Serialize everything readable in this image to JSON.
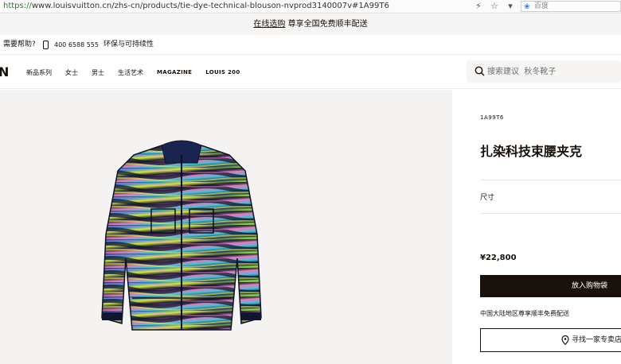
{
  "browser": {
    "url_scheme": "https://",
    "url_rest": "www.louisvuitton.cn/zhs-cn/products/tie-dye-technical-blouson-nvprod3140007v#1A99T6",
    "search_engine": "百度",
    "icons": [
      "lightning-icon",
      "star-icon",
      "dropdown-icon"
    ]
  },
  "announcement": {
    "link": "在线选购",
    "text": " 尊享全国免费顺丰配送"
  },
  "utility": {
    "help": "需要帮助?",
    "phone": "400 6588 555",
    "eco": "环保与可持续性"
  },
  "nav": {
    "logo_fragment": "N",
    "items": [
      "新品系列",
      "女士",
      "男士",
      "生活艺术",
      "MAGAZINE",
      "LOUIS 200"
    ],
    "search_placeholder": "搜索建议  秋冬靴子"
  },
  "product": {
    "sku": "1A99T6",
    "title": "扎染科技束腰夹克",
    "size_label": "尺寸",
    "price": "¥22,800",
    "add_to_cart": "放入购物袋",
    "shipping_note": "中国大陆地区尊享顺丰免费配送",
    "find_store": "寻找一家专卖店"
  },
  "colors": {
    "dark": "#19110b",
    "panel_bg": "#f4f3f1",
    "announce_bg": "#f6f5f3"
  }
}
